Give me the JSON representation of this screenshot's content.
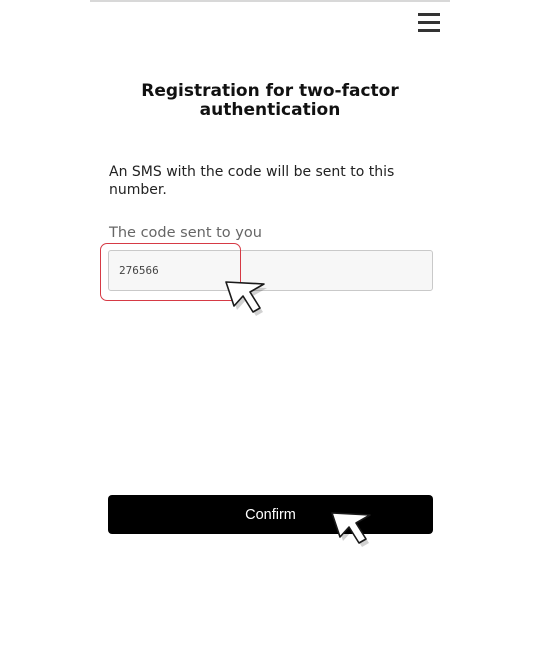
{
  "header": {
    "menu_icon": "hamburger-menu-icon"
  },
  "main": {
    "title": "Registration for two-factor authentication",
    "info_text": "An SMS with the code will be sent to this number.",
    "code_field": {
      "label": "The code sent to you",
      "value": "276566",
      "placeholder": ""
    },
    "confirm_label": "Confirm"
  },
  "overlay": {
    "highlight_color": "#d63a45",
    "cursor_icon": "arrow-pointer-icon"
  },
  "colors": {
    "button_bg": "#000000",
    "button_text": "#ffffff",
    "input_bg": "#f7f7f7"
  }
}
